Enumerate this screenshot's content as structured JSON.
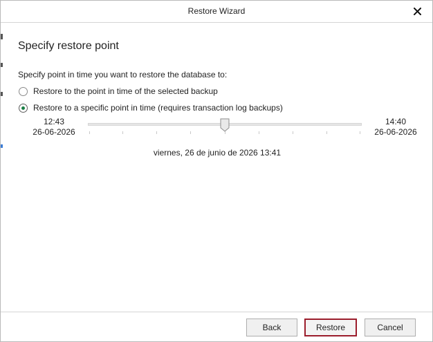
{
  "window": {
    "title": "Restore Wizard"
  },
  "page": {
    "heading": "Specify restore point",
    "prompt": "Specify point in time you want to restore the database to:"
  },
  "options": [
    {
      "label": "Restore to the point in time of the selected backup",
      "checked": false
    },
    {
      "label": "Restore to a specific point in time (requires transaction log backups)",
      "checked": true
    }
  ],
  "slider": {
    "start_time": "12:43",
    "start_date": "26-06-2026",
    "end_time": "14:40",
    "end_date": "26-06-2026",
    "position_fraction": 0.5
  },
  "selected_datetime": "viernes, 26 de junio de 2026 13:41",
  "buttons": {
    "back": "Back",
    "restore": "Restore",
    "cancel": "Cancel"
  },
  "icons": {
    "close": "close-icon",
    "radio": "radio-icon",
    "slider_thumb": "slider-thumb-icon"
  },
  "colors": {
    "primary_border": "#9b1c2b",
    "radio_selected": "#1a7f45"
  }
}
